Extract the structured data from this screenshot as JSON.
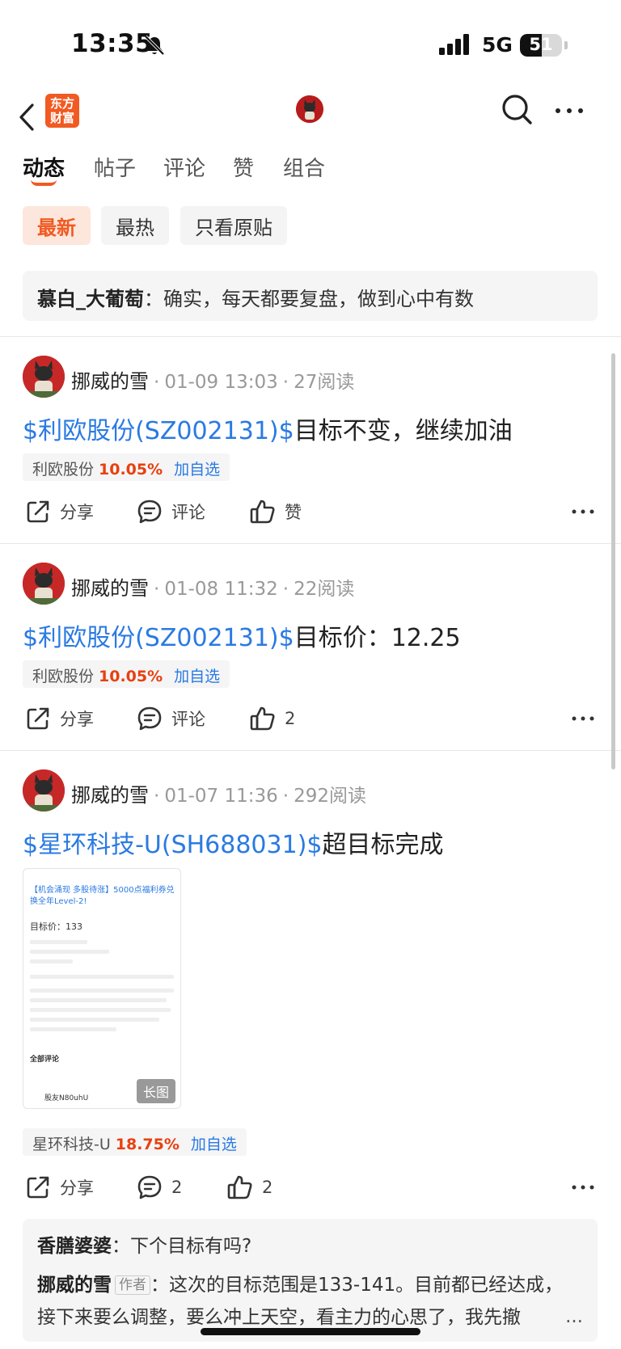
{
  "status_bar": {
    "time": "13:35",
    "network": "5G",
    "battery": "51",
    "battery_level": 0.51
  },
  "nav": {
    "logo_line1": "东方",
    "logo_line2": "财富"
  },
  "tabs": [
    {
      "label": "动态",
      "active": true
    },
    {
      "label": "帖子",
      "active": false
    },
    {
      "label": "评论",
      "active": false
    },
    {
      "label": "赞",
      "active": false
    },
    {
      "label": "组合",
      "active": false
    }
  ],
  "filters": [
    {
      "label": "最新",
      "active": true
    },
    {
      "label": "最热",
      "active": false
    },
    {
      "label": "只看原贴",
      "active": false
    }
  ],
  "pinned_comment": {
    "author": "慕白_大葡萄",
    "separator": "：",
    "text": "确实，每天都要复盘，做到心中有数"
  },
  "posts": [
    {
      "author": "挪威的雪",
      "date": "01-09 13:03",
      "reads": "27阅读",
      "stock_link": "$利欧股份(SZ002131)$",
      "text": "目标不变，继续加油",
      "tag_name": "利欧股份",
      "tag_pct": "10.05%",
      "tag_add": "加自选",
      "share": "分享",
      "comment": "评论",
      "like": "赞"
    },
    {
      "author": "挪威的雪",
      "date": "01-08 11:32",
      "reads": "22阅读",
      "stock_link": "$利欧股份(SZ002131)$",
      "text": "目标价：12.25",
      "tag_name": "利欧股份",
      "tag_pct": "10.05%",
      "tag_add": "加自选",
      "share": "分享",
      "comment": "评论",
      "like": "2"
    },
    {
      "author": "挪威的雪",
      "date": "01-07 11:36",
      "reads": "292阅读",
      "stock_link": "$星环科技-U(SH688031)$",
      "text": "超目标完成",
      "tag_name": "星环科技-U",
      "tag_pct": "18.75%",
      "tag_add": "加自选",
      "share": "分享",
      "comment": "2",
      "like": "2",
      "thumbnail": {
        "header": "【机会涌现 多股待涨】5000点福利券兑换全年Level-2!",
        "target": "目标价：133",
        "comments": "全部评论",
        "user": "股友N80uhU",
        "badge": "长图"
      }
    }
  ],
  "comments": [
    {
      "author": "香膳婆婆",
      "separator": "：",
      "text": "下个目标有吗?"
    },
    {
      "author": "挪威的雪",
      "badge": "作者",
      "separator": "：",
      "text": "这次的目标范围是133-141。目前都已经达成，",
      "text2": "接下来要么调整，要么冲上天空，看主力的心思了，我先撤",
      "more": "..."
    }
  ],
  "colors": {
    "accent": "#f15a22",
    "link": "#2a7ae2",
    "up": "#e8400f"
  }
}
